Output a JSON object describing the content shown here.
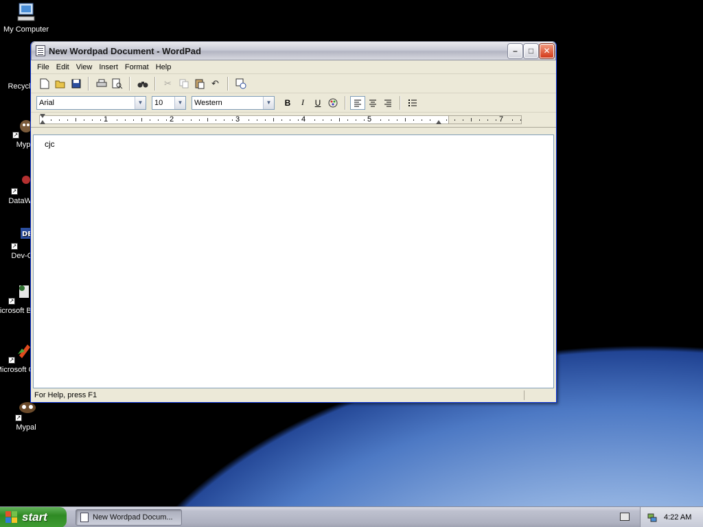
{
  "desktop": {
    "icons": [
      {
        "label": "My Computer"
      },
      {
        "label": "Recycl"
      },
      {
        "label": "Myp"
      },
      {
        "label": "DataWa"
      },
      {
        "label": "Dev-C"
      },
      {
        "label": "Microsoft Basic"
      },
      {
        "label": "Microsoft C++"
      },
      {
        "label": "Mypal"
      }
    ]
  },
  "window": {
    "title": "New Wordpad Document - WordPad",
    "minimize_label": "–",
    "maximize_label": "□",
    "close_label": "✕",
    "menu": [
      "File",
      "Edit",
      "View",
      "Insert",
      "Format",
      "Help"
    ],
    "toolbar_icons": [
      "new-icon",
      "open-icon",
      "save-icon",
      "print-icon",
      "print-preview-icon",
      "find-icon",
      "cut-icon",
      "copy-icon",
      "paste-icon",
      "undo-icon",
      "date-time-icon"
    ],
    "format": {
      "font": "Arial",
      "size": "10",
      "script": "Western",
      "bold_label": "B",
      "italic_label": "I",
      "underline_label": "U"
    },
    "ruler_numbers": [
      "1",
      "2",
      "3",
      "4",
      "5",
      "7"
    ],
    "document_text": "cjc",
    "status_text": "For Help, press F1"
  },
  "taskbar": {
    "start_label": "start",
    "task_label": "New Wordpad Docum...",
    "clock": "4:22 AM"
  }
}
